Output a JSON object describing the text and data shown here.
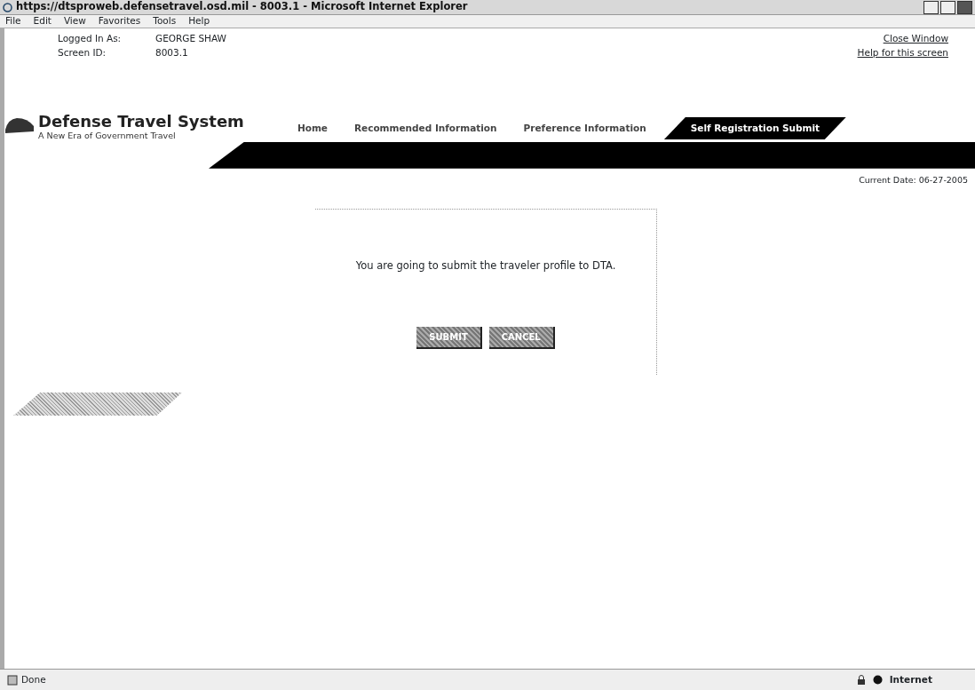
{
  "window": {
    "title": "https://dtsproweb.defensetravel.osd.mil - 8003.1 - Microsoft Internet Explorer"
  },
  "menu": [
    "File",
    "Edit",
    "View",
    "Favorites",
    "Tools",
    "Help"
  ],
  "header": {
    "fields": [
      {
        "label": "Logged In As:",
        "value": "GEORGE SHAW"
      },
      {
        "label": "Screen ID:",
        "value": "8003.1"
      }
    ],
    "links": [
      "Close Window",
      "Help for this screen"
    ]
  },
  "logo": {
    "title": "Defense Travel System",
    "tagline": "A New Era of Government Travel"
  },
  "tabs": [
    {
      "label": "Home",
      "selected": false
    },
    {
      "label": "Recommended Information",
      "selected": false
    },
    {
      "label": "Preference Information",
      "selected": false
    },
    {
      "label": "Self Registration Submit",
      "selected": true
    }
  ],
  "current_date": "Current Date: 06-27-2005",
  "dialog": {
    "message": "You are going to submit the traveler profile to DTA.",
    "buttons": [
      "SUBMIT",
      "CANCEL"
    ]
  },
  "status_bar": {
    "text": "Done",
    "zone": "Internet"
  }
}
